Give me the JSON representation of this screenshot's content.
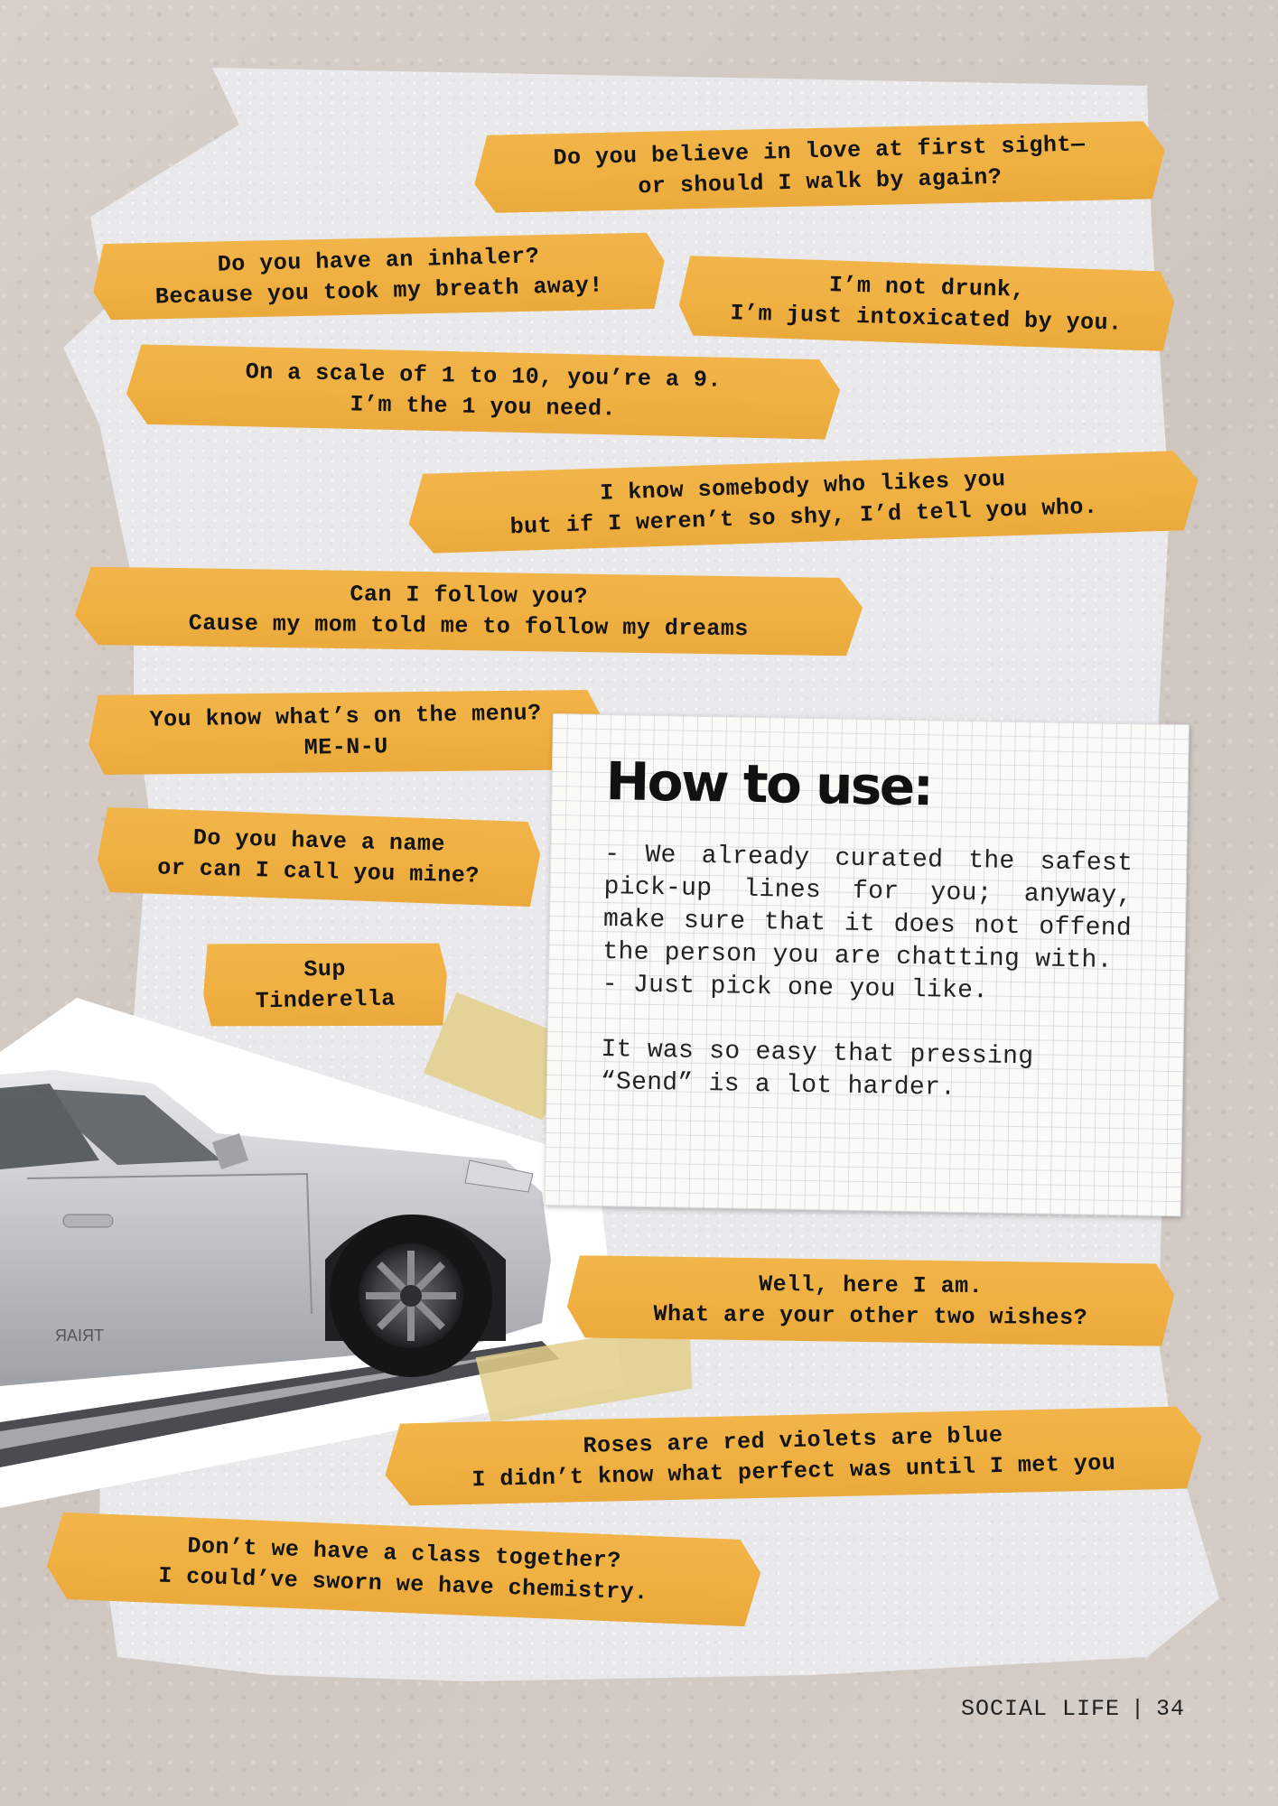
{
  "tapes": [
    {
      "id": "love-first-sight",
      "lines": [
        "Do you believe in love at first sight—",
        "or should I walk by again?"
      ]
    },
    {
      "id": "inhaler",
      "lines": [
        "Do you have an inhaler?",
        "Because you took my breath away!"
      ]
    },
    {
      "id": "not-drunk",
      "lines": [
        "I’m not drunk,",
        "I’m just intoxicated by you."
      ]
    },
    {
      "id": "scale",
      "lines": [
        "On a scale of 1 to 10, you’re a 9.",
        "I’m the 1 you need."
      ]
    },
    {
      "id": "somebody-likes-you",
      "lines": [
        "I know somebody who likes you",
        "but if I weren’t so shy, I’d tell you who."
      ]
    },
    {
      "id": "follow-you",
      "lines": [
        "Can I follow you?",
        "Cause my mom told me to follow my dreams"
      ]
    },
    {
      "id": "menu",
      "lines": [
        "You know what’s on the menu?",
        "ME-N-U"
      ]
    },
    {
      "id": "name",
      "lines": [
        "Do you have a name",
        "or can I call you mine?"
      ]
    },
    {
      "id": "tinderella",
      "lines": [
        "Sup",
        "Tinderella"
      ]
    },
    {
      "id": "two-wishes",
      "lines": [
        "Well, here I am.",
        "What are your other two wishes?"
      ]
    },
    {
      "id": "roses",
      "lines": [
        "Roses are red violets are blue",
        "I didn’t know what perfect was until I met you"
      ]
    },
    {
      "id": "chemistry",
      "lines": [
        "Don’t we have a class together?",
        "I could’ve sworn we have chemistry."
      ]
    }
  ],
  "note": {
    "title": "How to use:",
    "paragraph1": "- We already curated the safest pick-up lines for you; anyway, make sure that it does not offend the person you are chatting with.",
    "paragraph2": "- Just pick one you like.",
    "paragraph3": "It was so easy that pressing “Send” is a lot harder."
  },
  "footer": {
    "section": "SOCIAL LIFE",
    "separator": "|",
    "page": "34"
  },
  "colors": {
    "tape": "#f0b042",
    "paper": "#e9e8ea",
    "background": "#d3cac4"
  }
}
